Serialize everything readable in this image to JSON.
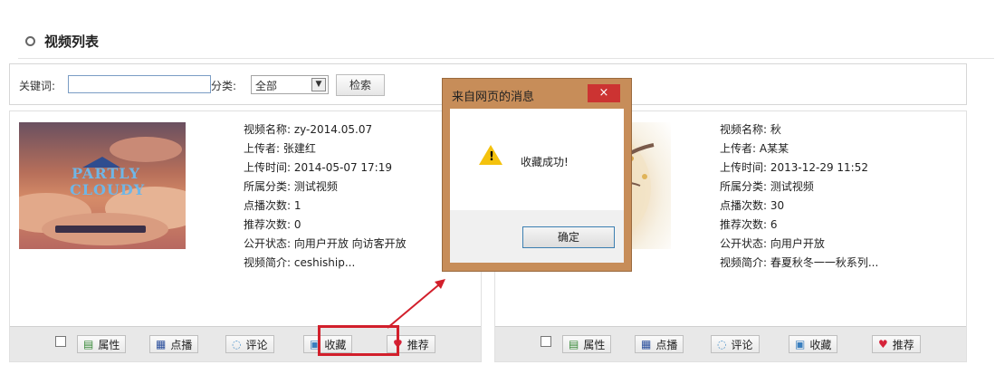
{
  "section": {
    "title": "视频列表"
  },
  "search": {
    "keyword_label": "关键词:",
    "keyword_value": "",
    "category_label": "分类:",
    "category_selected": "全部",
    "search_button": "检索"
  },
  "videos": [
    {
      "name": "视频名称: zy-2014.05.07",
      "uploader": "上传者: 张建红",
      "upload_time": "上传时间: 2014-05-07 17:19",
      "category": "所属分类: 测试视频",
      "plays": "点播次数: 1",
      "recommends": "推荐次数: 0",
      "visibility": "公开状态: 向用户开放 向访客开放",
      "intro": "视频简介: ceshiship...",
      "thumb_text": "PARTLY CLOUDY",
      "actions": [
        "属性",
        "点播",
        "评论",
        "收藏",
        "推荐"
      ]
    },
    {
      "name": "视频名称: 秋",
      "uploader": "上传者: A某某",
      "upload_time": "上传时间: 2013-12-29 11:52",
      "category": "所属分类: 测试视频",
      "plays": "点播次数: 30",
      "recommends": "推荐次数: 6",
      "visibility": "公开状态: 向用户开放",
      "intro": "视频简介: 春夏秋冬一一秋系列...",
      "actions": [
        "属性",
        "点播",
        "评论",
        "收藏",
        "推荐"
      ]
    }
  ],
  "dialog": {
    "title": "来自网页的消息",
    "close": "×",
    "message": "收藏成功!",
    "ok_button": "确定",
    "icon": "warning-icon"
  },
  "colors": {
    "highlight": "#d21f2b",
    "dialog_frame": "#c78d59",
    "dialog_close": "#cc3332"
  }
}
